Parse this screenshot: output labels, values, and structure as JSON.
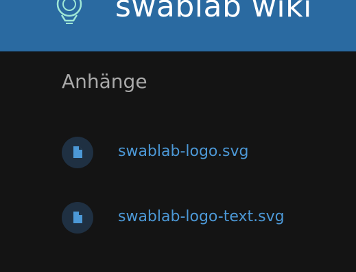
{
  "header": {
    "site_title": "swablab wiki",
    "logo_icon": "gear-bulb-logo"
  },
  "attachments": {
    "heading": "Anhänge",
    "items": [
      {
        "filename": "swablab-logo.svg",
        "icon": "file-icon"
      },
      {
        "filename": "swablab-logo-text.svg",
        "icon": "file-icon"
      }
    ]
  },
  "colors": {
    "header_bg": "#2a6aa1",
    "page_bg": "#141414",
    "link": "#4c98d6",
    "heading": "#a9a9a9",
    "badge_bg": "#1f3042"
  }
}
